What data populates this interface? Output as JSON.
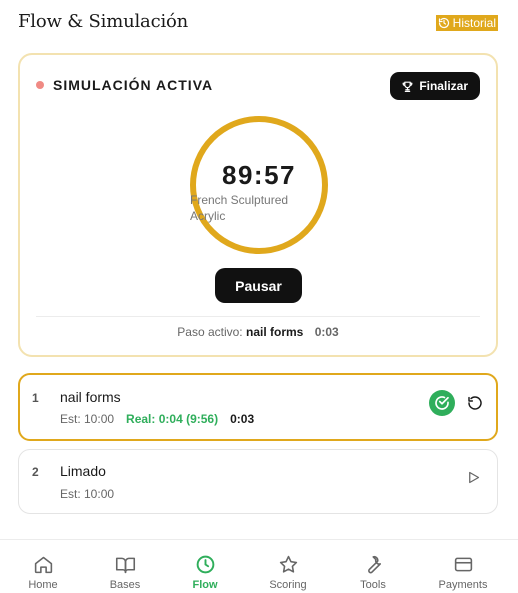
{
  "header": {
    "title": "Flow & Simulación",
    "historial_label": "Historial"
  },
  "simulation": {
    "title": "SIMULACIÓN ACTIVA",
    "finalizar_label": "Finalizar",
    "timer": "89:57",
    "technique": "French Sculptured Acrylic",
    "pause_label": "Pausar",
    "active_step_prefix": "Paso activo:",
    "active_step_name": "nail forms",
    "active_step_time": "0:03"
  },
  "steps": [
    {
      "number": "1",
      "name": "nail forms",
      "estimate": "Est: 10:00",
      "real": "Real: 0:04 (9:56)",
      "elapsed": "0:03",
      "status": "active"
    },
    {
      "number": "2",
      "name": "Limado",
      "estimate": "Est: 10:00",
      "status": "pending"
    }
  ],
  "nav": {
    "items": [
      {
        "label": "Home",
        "icon": "home-icon"
      },
      {
        "label": "Bases",
        "icon": "book-icon"
      },
      {
        "label": "Flow",
        "icon": "clock-icon",
        "active": true
      },
      {
        "label": "Scoring",
        "icon": "star-icon"
      },
      {
        "label": "Tools",
        "icon": "wrench-icon"
      },
      {
        "label": "Payments",
        "icon": "credit-card-icon"
      }
    ]
  },
  "colors": {
    "accent_gold": "#e0a81c",
    "card_border": "#f3e2b0",
    "success_green": "#2fae5b",
    "live_dot": "#f08a84",
    "dark_button": "#111111"
  }
}
